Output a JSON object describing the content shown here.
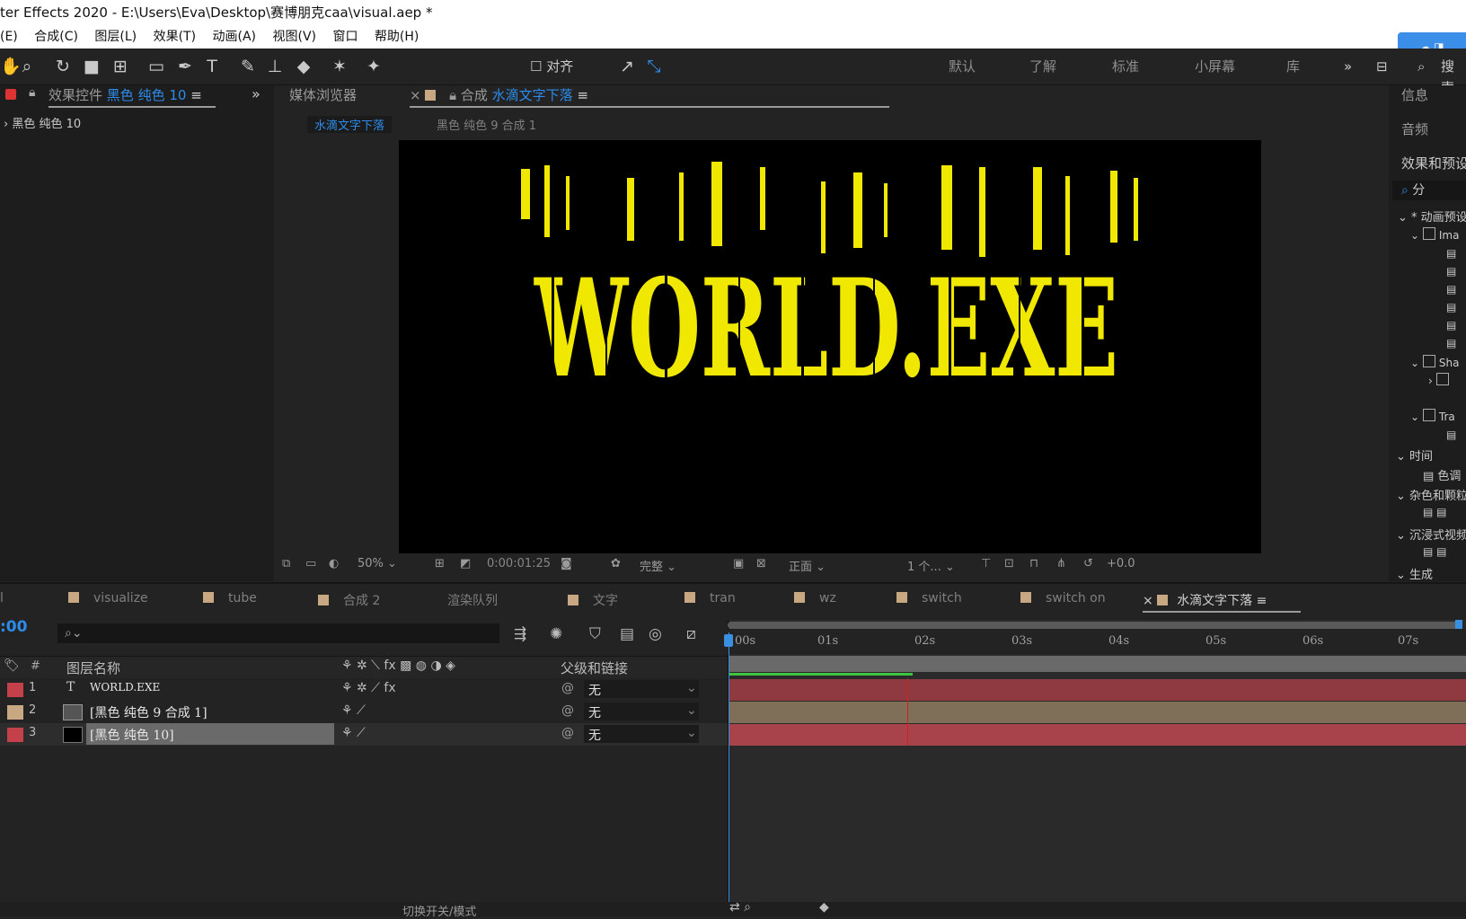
{
  "window": {
    "title": "ter Effects 2020 - E:\\Users\\Eva\\Desktop\\赛博朋克caa\\visual.aep *"
  },
  "menu": [
    "(E)",
    "合成(C)",
    "图层(L)",
    "效果(T)",
    "动画(A)",
    "视图(V)",
    "窗口",
    "帮助(H)"
  ],
  "toolbar": {
    "align_label": "对齐",
    "workspaces": [
      "默认",
      "了解",
      "标准",
      "小屏幕",
      "库"
    ],
    "search_label": "搜索"
  },
  "effects_panel": {
    "tab_prefix": "效果控件",
    "tab_target": "黑色 纯色 10",
    "layer_label": "黑色 纯色 10"
  },
  "comp_panel": {
    "media_tab": "媒体浏览器",
    "comp_prefix": "合成",
    "comp_name": "水滴文字下落",
    "breadcrumb_active": "水滴文字下落",
    "breadcrumb_next": "黑色 纯色 9 合成 1",
    "canvas_text": "WORLD.EXE",
    "zoom": "50%",
    "timecode": "0:00:01:25",
    "resolution": "完整",
    "view": "正面",
    "views_count": "1 个...",
    "exposure": "+0.0"
  },
  "right_panel": {
    "info": "信息",
    "audio": "音频",
    "effects_presets": "效果和预设",
    "search_placeholder": "分",
    "tree": [
      "动画预设",
      "Ima",
      "Sha",
      "Tra",
      "时间",
      "色调",
      "杂色和颗粒",
      "沉浸式视频",
      "生成"
    ]
  },
  "timeline": {
    "tabs": [
      "visualize",
      "tube",
      "合成 2",
      "渲染队列",
      "文字",
      "tran",
      "wz",
      "switch",
      "switch on",
      "水滴文字下落"
    ],
    "current_time": ":00",
    "col_name": "图层名称",
    "col_num": "#",
    "col_parent": "父级和链接",
    "ruler": [
      "00s",
      "01s",
      "02s",
      "03s",
      "04s",
      "05s",
      "06s",
      "07s"
    ],
    "layers": [
      {
        "num": "1",
        "name": "WORLD.EXE",
        "parent": "无",
        "color": "#c4404b",
        "bar_color": "#8f3a41"
      },
      {
        "num": "2",
        "name": "[黑色 纯色 9 合成 1]",
        "parent": "无",
        "color": "#c8a882",
        "bar_color": "#7f6f58"
      },
      {
        "num": "3",
        "name": "[黑色 纯色 10]",
        "parent": "无",
        "color": "#c4404b",
        "bar_color": "#a8434c"
      }
    ],
    "footer": "切换开关/模式"
  },
  "colors": {
    "accent": "#2d8ceb",
    "playhead": "#3a8fe0",
    "current_time_line": "#d02020",
    "canvas_text": "#f0e800"
  }
}
